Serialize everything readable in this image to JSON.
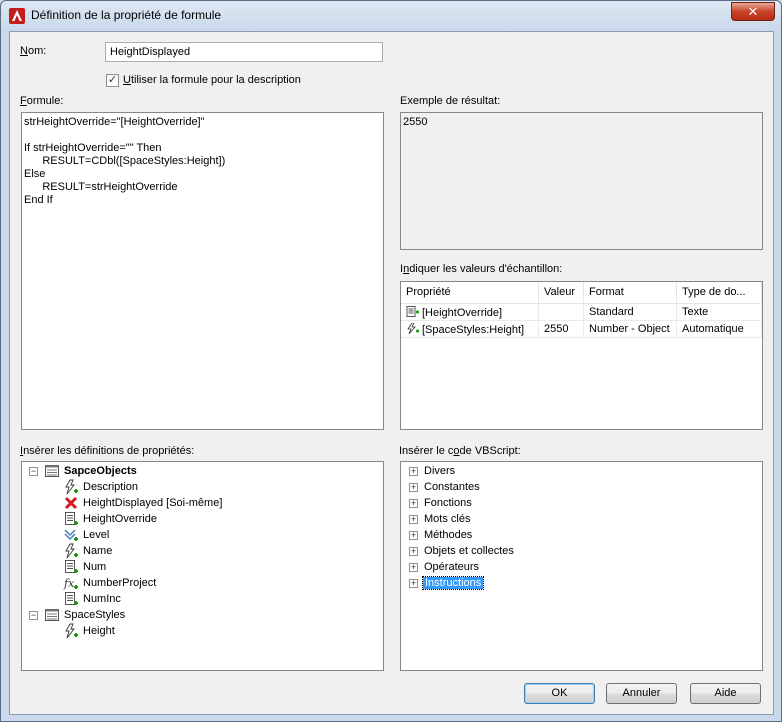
{
  "window": {
    "title": "Définition de la propriété de formule",
    "close_symbol": "✕",
    "colors": {
      "selection": "#3399ff",
      "close_button": "#c7442c"
    }
  },
  "name_field": {
    "label_hotkey": "N",
    "label_rest": "om:",
    "value": "HeightDisplayed"
  },
  "use_formula_checkbox": {
    "checked": true,
    "check_glyph": "✓",
    "label_hotkey": "U",
    "label_rest": "tiliser la formule pour la description"
  },
  "formula": {
    "label_hotkey": "F",
    "label_rest": "ormule:",
    "lines": [
      "strHeightOverride=\"[HeightOverride]\"",
      "",
      "If strHeightOverride=\"\" Then",
      "      RESULT=CDbl([SpaceStyles:Height])",
      "Else",
      "      RESULT=strHeightOverride",
      "End If"
    ]
  },
  "result": {
    "label": "Exemple de résultat:",
    "value": "2550"
  },
  "sample_values": {
    "label_pre": "I",
    "label_hotkey": "n",
    "label_rest": "diquer les valeurs d'échantillon:",
    "columns": [
      "Propriété",
      "Valeur",
      "Format",
      "Type de do..."
    ],
    "rows": [
      {
        "icon": "property-definition-icon",
        "property": "[HeightOverride]",
        "value": "",
        "format": "Standard",
        "type": "Texte"
      },
      {
        "icon": "automatic-property-icon",
        "property": "[SpaceStyles:Height]",
        "value": "2550",
        "format": "Number - Object",
        "type": "Automatique"
      }
    ]
  },
  "property_tree": {
    "label_hotkey": "I",
    "label_rest": "nsérer les définitions de propriétés:",
    "groups": [
      {
        "name": "SapceObjects",
        "expander": "−",
        "bold": true,
        "items": [
          {
            "icon": "automatic-property-icon",
            "label": "Description"
          },
          {
            "icon": "error-x-icon",
            "label": "HeightDisplayed [Soi-même]"
          },
          {
            "icon": "property-definition-icon",
            "label": "HeightOverride"
          },
          {
            "icon": "list-property-icon",
            "label": "Level"
          },
          {
            "icon": "automatic-property-icon",
            "label": "Name"
          },
          {
            "icon": "property-definition-icon",
            "label": "Num"
          },
          {
            "icon": "formula-property-icon",
            "label": "NumberProject"
          },
          {
            "icon": "property-definition-icon",
            "label": "NumInc"
          }
        ]
      },
      {
        "name": "SpaceStyles",
        "expander": "−",
        "bold": false,
        "items": [
          {
            "icon": "automatic-property-icon",
            "label": "Height"
          }
        ]
      }
    ]
  },
  "vbscript_tree": {
    "label_pre": "Insérer le c",
    "label_hotkey": "o",
    "label_rest": "de VBScript:",
    "items": [
      {
        "label": "Divers",
        "expander": "+"
      },
      {
        "label": "Constantes",
        "expander": "+"
      },
      {
        "label": "Fonctions",
        "expander": "+"
      },
      {
        "label": "Mots clés",
        "expander": "+"
      },
      {
        "label": "Méthodes",
        "expander": "+"
      },
      {
        "label": "Objets et collectes",
        "expander": "+"
      },
      {
        "label": "Opérateurs",
        "expander": "+"
      },
      {
        "label": "Instructions",
        "expander": "+",
        "selected": true
      }
    ]
  },
  "buttons": {
    "ok": "OK",
    "cancel": "Annuler",
    "help": "Aide"
  }
}
